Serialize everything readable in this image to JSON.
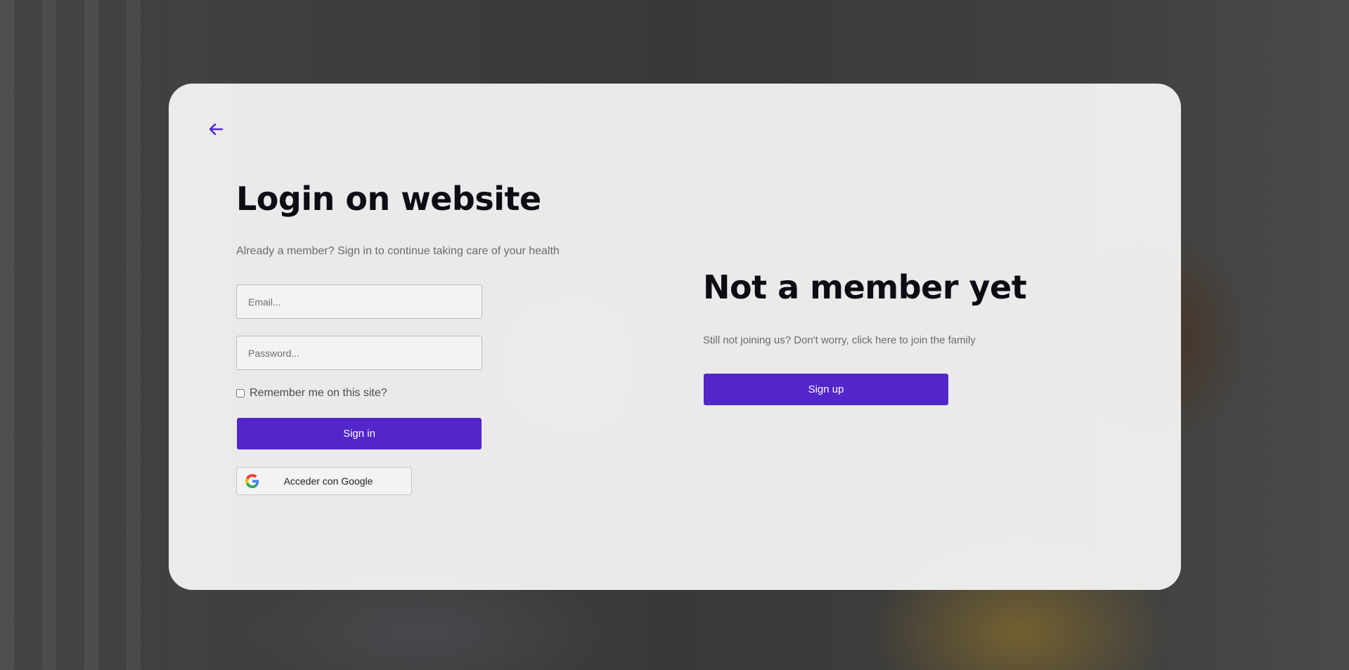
{
  "login": {
    "title": "Login on website",
    "subtitle": "Already a member? Sign in to continue taking care of your health",
    "email_placeholder": "Email...",
    "password_placeholder": "Password...",
    "remember_label": "Remember me on this site?",
    "signin_label": "Sign in",
    "google_label": "Acceder con Google"
  },
  "signup": {
    "title": "Not a member yet",
    "subtitle": "Still not joining us? Don't worry, click here to join the family",
    "signup_label": "Sign up"
  },
  "colors": {
    "accent": "#5226c9",
    "title": "#0c0c14",
    "subtitle": "#6b6b6b"
  },
  "icons": {
    "back": "arrow-left-icon",
    "google": "google-icon"
  }
}
